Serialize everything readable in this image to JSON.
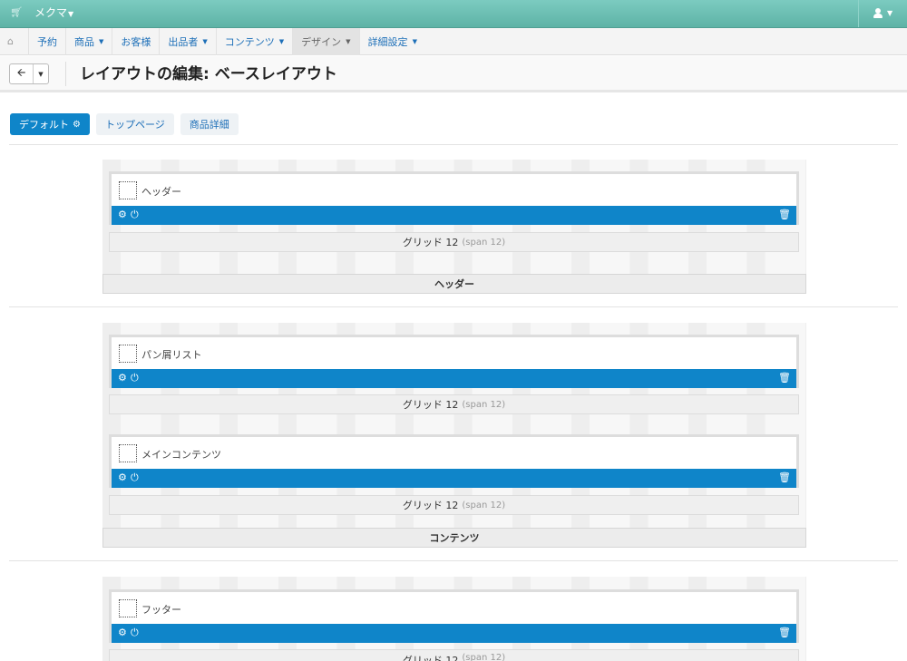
{
  "topbar": {
    "brand": "メクマ",
    "cart_icon": "cart-icon",
    "user_icon": "user-icon"
  },
  "nav": {
    "items": [
      {
        "label": "予約",
        "dropdown": false
      },
      {
        "label": "商品",
        "dropdown": true
      },
      {
        "label": "お客様",
        "dropdown": false
      },
      {
        "label": "出品者",
        "dropdown": true
      },
      {
        "label": "コンテンツ",
        "dropdown": true
      },
      {
        "label": "デザイン",
        "dropdown": true,
        "active": true
      },
      {
        "label": "詳細設定",
        "dropdown": true
      }
    ]
  },
  "title": "レイアウトの編集: ベースレイアウト",
  "tabs": [
    {
      "label": "デフォルト",
      "active": true
    },
    {
      "label": "トップページ",
      "active": false
    },
    {
      "label": "商品詳細",
      "active": false
    }
  ],
  "grid": {
    "label": "グリッド 12",
    "span": "(span 12)"
  },
  "sections": [
    {
      "label": "ヘッダー",
      "blocks": [
        "ヘッダー"
      ]
    },
    {
      "label": "コンテンツ",
      "blocks": [
        "パン屑リスト",
        "メインコンテンツ"
      ]
    },
    {
      "label": "",
      "blocks": [
        "フッター"
      ]
    }
  ],
  "colors": {
    "accent": "#0f85c9",
    "topbar": "#6dbfb3"
  }
}
